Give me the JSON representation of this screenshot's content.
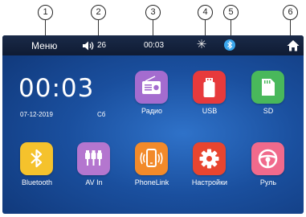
{
  "callouts": [
    "1",
    "2",
    "3",
    "4",
    "5",
    "6"
  ],
  "statusbar": {
    "menu_label": "Меню",
    "volume": "26",
    "clock": "00:03",
    "bluetooth_icon": "bluetooth-icon",
    "brightness_icon": "sun-icon",
    "home_icon": "home-icon"
  },
  "clock": {
    "time": "00:03",
    "date": "07-12-2019",
    "day": "Сб"
  },
  "apps": [
    {
      "label": "Радио",
      "icon": "radio-icon",
      "color": "#a46ccf"
    },
    {
      "label": "USB",
      "icon": "usb-icon",
      "color": "#e73a3c"
    },
    {
      "label": "SD",
      "icon": "sd-card-icon",
      "color": "#49b85b"
    },
    {
      "label": "Bluetooth",
      "icon": "bluetooth-icon",
      "color": "#f5c22c"
    },
    {
      "label": "AV In",
      "icon": "av-in-icon",
      "color": "#b476cf"
    },
    {
      "label": "PhoneLink",
      "icon": "phonelink-icon",
      "color": "#f28a2a"
    },
    {
      "label": "Настройки",
      "icon": "settings-gear-icon",
      "color": "#e8452f"
    },
    {
      "label": "Руль",
      "icon": "steering-wheel-icon",
      "color": "#f06a8c"
    }
  ]
}
